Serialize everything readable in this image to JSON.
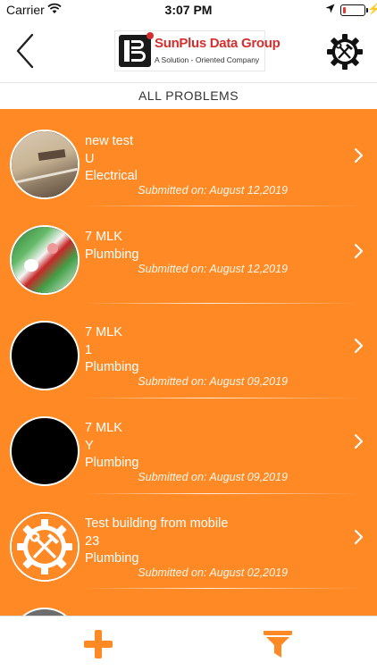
{
  "status_bar": {
    "carrier": "Carrier",
    "time": "3:07 PM"
  },
  "header": {
    "logo_name": "SunPlus Data Group",
    "logo_tagline": "A Solution - Oriented Company"
  },
  "section_title": "ALL PROBLEMS",
  "problems": [
    {
      "line1": "new test",
      "line2": "U",
      "line3": "Electrical",
      "submitted": "Submitted on: August 12,2019",
      "thumb": "hallway-photo"
    },
    {
      "line1": "7 MLK",
      "line2": "Plumbing",
      "line3": "",
      "submitted": "Submitted on: August 12,2019",
      "thumb": "floral-photo"
    },
    {
      "line1": "7 MLK",
      "line2": "1",
      "line3": "Plumbing",
      "submitted": "Submitted on: August 09,2019",
      "thumb": "black-image"
    },
    {
      "line1": "7 MLK",
      "line2": "Y",
      "line3": "Plumbing",
      "submitted": "Submitted on: August 09,2019",
      "thumb": "black-image"
    },
    {
      "line1": "Test building from mobile",
      "line2": "23",
      "line3": "Plumbing",
      "submitted": "Submitted on: August 02,2019",
      "thumb": "gear-tools-icon"
    }
  ],
  "colors": {
    "list_background": "#ff8a25",
    "accent": "#ff8a25",
    "logo_red": "#d32f2f"
  },
  "icons": {
    "back": "chevron-left-icon",
    "settings": "gear-tools-icon",
    "add": "plus-icon",
    "filter": "filter-icon",
    "row": "chevron-right-icon"
  }
}
